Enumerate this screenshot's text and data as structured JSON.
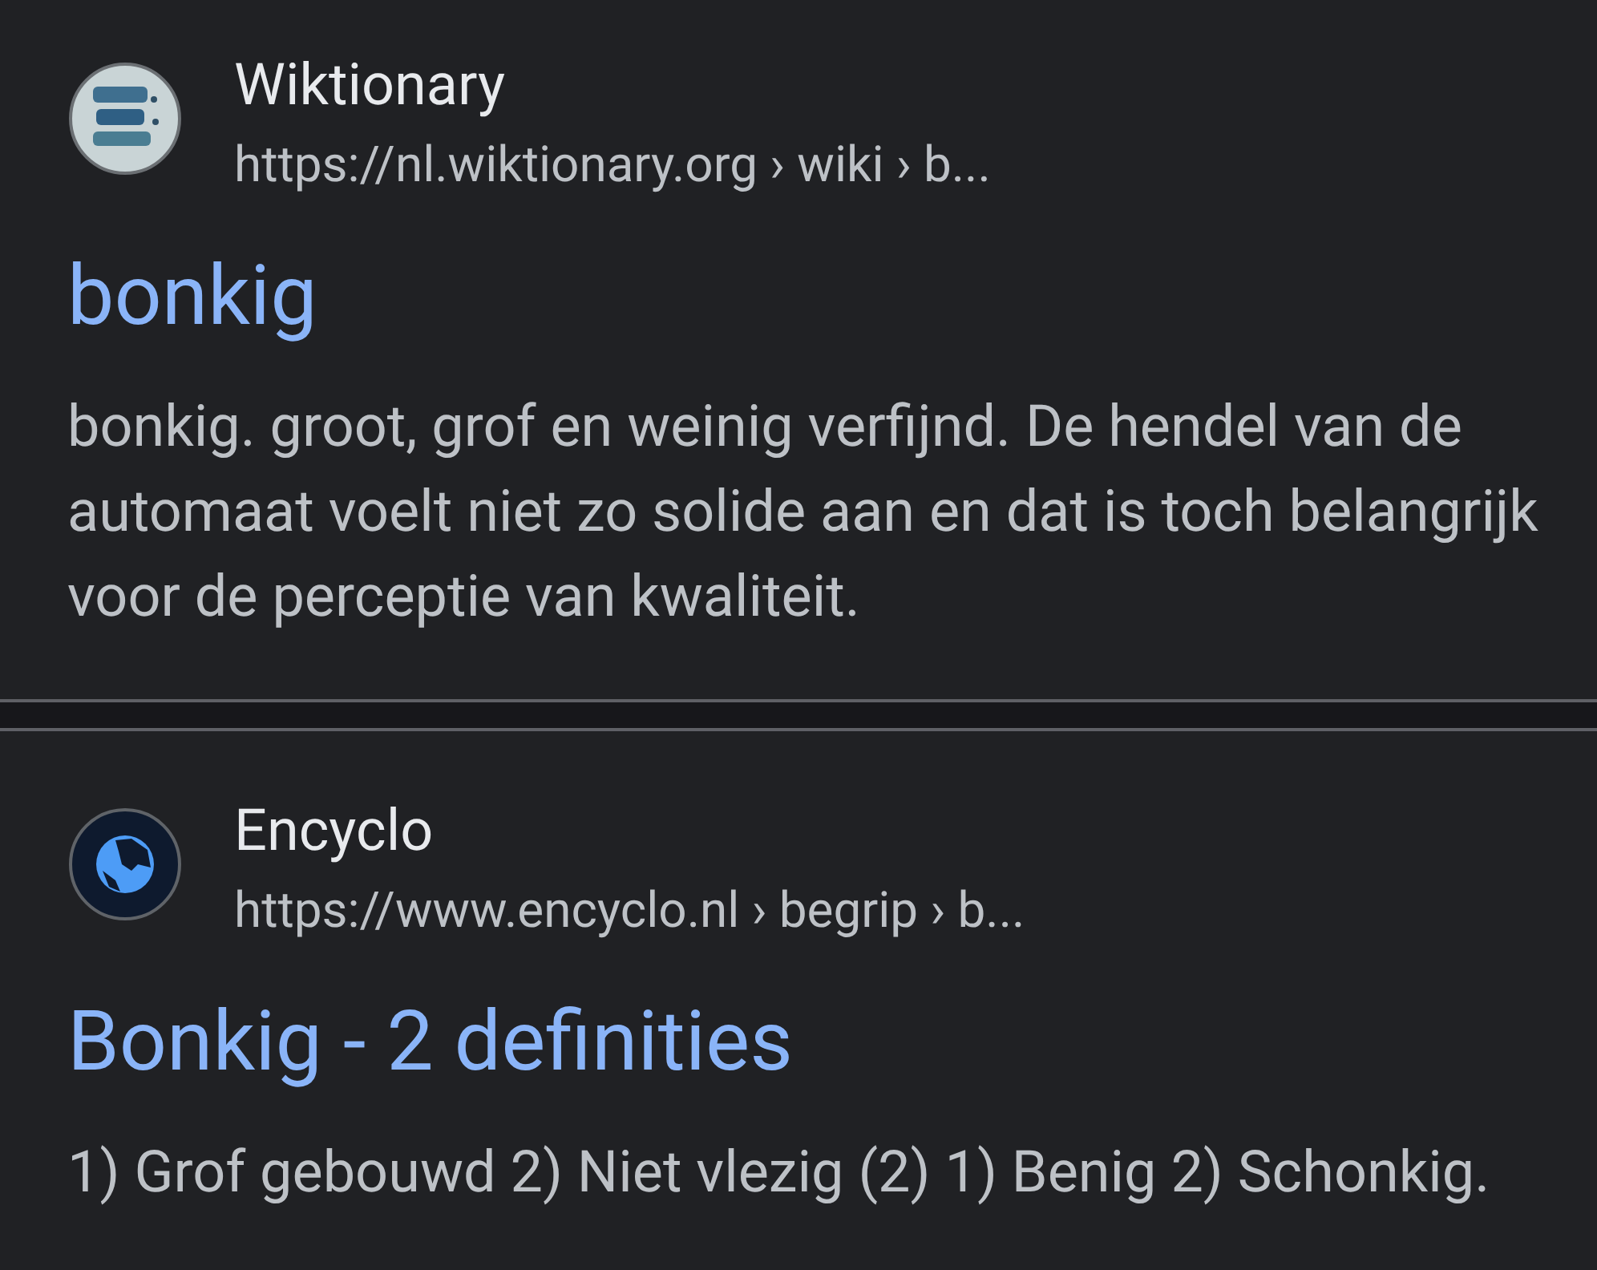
{
  "results": [
    {
      "kind": "logo",
      "site": "Wiktionary",
      "url": "https://nl.wiktionary.org › wiki › b...",
      "title": "bonkig",
      "snippet": "bonkig. groot, grof en weinig verfijnd. De hendel van de automaat voelt niet zo solide aan en dat is toch belangrijk voor de perceptie van kwaliteit."
    },
    {
      "kind": "globe",
      "site": "Encyclo",
      "url": "https://www.encyclo.nl › begrip › b...",
      "title": "Bonkig - 2 definities",
      "snippet": "1) Grof gebouwd 2) Niet vlezig (2) 1) Benig 2) Schonkig."
    }
  ]
}
